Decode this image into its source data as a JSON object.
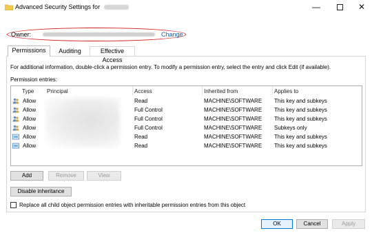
{
  "window": {
    "title": "Advanced Security Settings for",
    "minimize": "—",
    "close": "✕"
  },
  "owner": {
    "label": "Owner:",
    "change_link": "Change"
  },
  "tabs": [
    "Permissions",
    "Auditing",
    "Effective Access"
  ],
  "info_text": "For additional information, double-click a permission entry. To modify a permission entry, select the entry and click Edit (if available).",
  "entries_label": "Permission entries:",
  "columns": [
    "Type",
    "Principal",
    "Access",
    "Inherited from",
    "Applies to"
  ],
  "entries": [
    {
      "icon": "user-group-icon",
      "type": "Allow",
      "access": "Read",
      "inherited": "MACHINE\\SOFTWARE",
      "applies": "This key and subkeys"
    },
    {
      "icon": "user-group-icon",
      "type": "Allow",
      "access": "Full Control",
      "inherited": "MACHINE\\SOFTWARE",
      "applies": "This key and subkeys"
    },
    {
      "icon": "user-group-icon",
      "type": "Allow",
      "access": "Full Control",
      "inherited": "MACHINE\\SOFTWARE",
      "applies": "This key and subkeys"
    },
    {
      "icon": "user-group-icon",
      "type": "Allow",
      "access": "Full Control",
      "inherited": "MACHINE\\SOFTWARE",
      "applies": "Subkeys only"
    },
    {
      "icon": "package-icon",
      "type": "Allow",
      "access": "Read",
      "inherited": "MACHINE\\SOFTWARE",
      "applies": "This key and subkeys"
    },
    {
      "icon": "package-icon",
      "type": "Allow",
      "access": "Read",
      "inherited": "MACHINE\\SOFTWARE",
      "applies": "This key and subkeys"
    }
  ],
  "buttons": {
    "add": "Add",
    "remove": "Remove",
    "view": "View",
    "disable_inheritance": "Disable inheritance",
    "ok": "OK",
    "cancel": "Cancel",
    "apply": "Apply"
  },
  "replace_checkbox_label": "Replace all child object permission entries with inheritable permission entries from this object",
  "colors": {
    "highlight_ellipse": "#d01a1a",
    "link": "#1a5fb4",
    "default_button_border": "#0078d7"
  }
}
